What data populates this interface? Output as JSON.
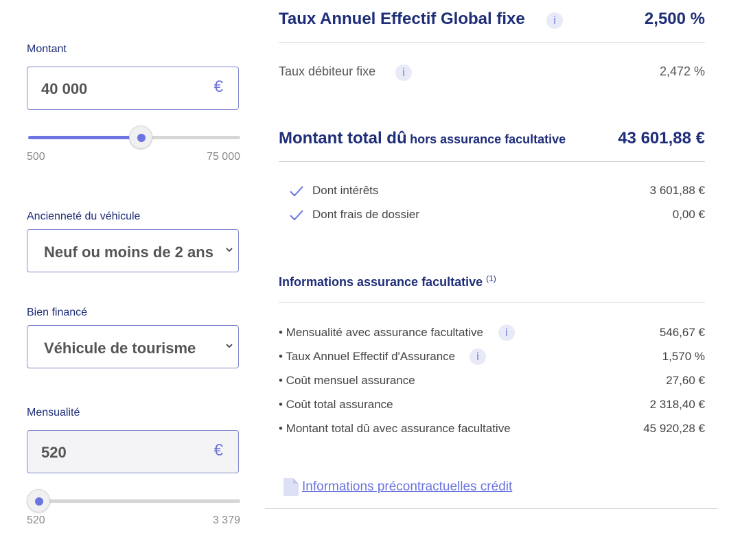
{
  "left": {
    "montant": {
      "label": "Montant",
      "value": "40 000",
      "currency": "€",
      "min": "500",
      "max": "75 000",
      "level": 0.53
    },
    "anciennete": {
      "label": "Ancienneté du véhicule",
      "value": "Neuf ou moins de 2 ans"
    },
    "bien": {
      "label": "Bien financé",
      "value": "Véhicule de tourisme"
    },
    "mensualite": {
      "label": "Mensualité",
      "value": "520",
      "currency": "€",
      "min": "520",
      "max": "3 379",
      "level": 0.0
    }
  },
  "right": {
    "taeg": {
      "label": "Taux Annuel Effectif Global fixe",
      "value": "2,500 %"
    },
    "taux_debiteur": {
      "label": "Taux débiteur fixe",
      "value": "2,472 %"
    },
    "total_du": {
      "label_main": "Montant total dû",
      "label_sub": "hors assurance facultative",
      "value": "43 601,88 €"
    },
    "details": [
      {
        "label": "Dont intérêts",
        "value": "3 601,88 €"
      },
      {
        "label": "Dont frais de dossier",
        "value": "0,00 €"
      }
    ],
    "assurance": {
      "title": "Informations assurance facultative",
      "note": "(1)",
      "rows": [
        {
          "label": "• Mensualité avec assurance facultative",
          "value": "546,67 €",
          "info": true
        },
        {
          "label": "• Taux Annuel Effectif d'Assurance",
          "value": "1,570 %",
          "info": true
        },
        {
          "label": "• Coût mensuel assurance",
          "value": "27,60 €",
          "info": false
        },
        {
          "label": "• Coût total assurance",
          "value": "2 318,40 €",
          "info": false
        },
        {
          "label": "• Montant total dû avec assurance facultative",
          "value": "45 920,28 €",
          "info": false
        }
      ]
    },
    "link": "Informations précontractuelles crédit"
  },
  "icons": {
    "info": "i",
    "accent": "#6b74e0",
    "title_color": "#1e2d78"
  }
}
